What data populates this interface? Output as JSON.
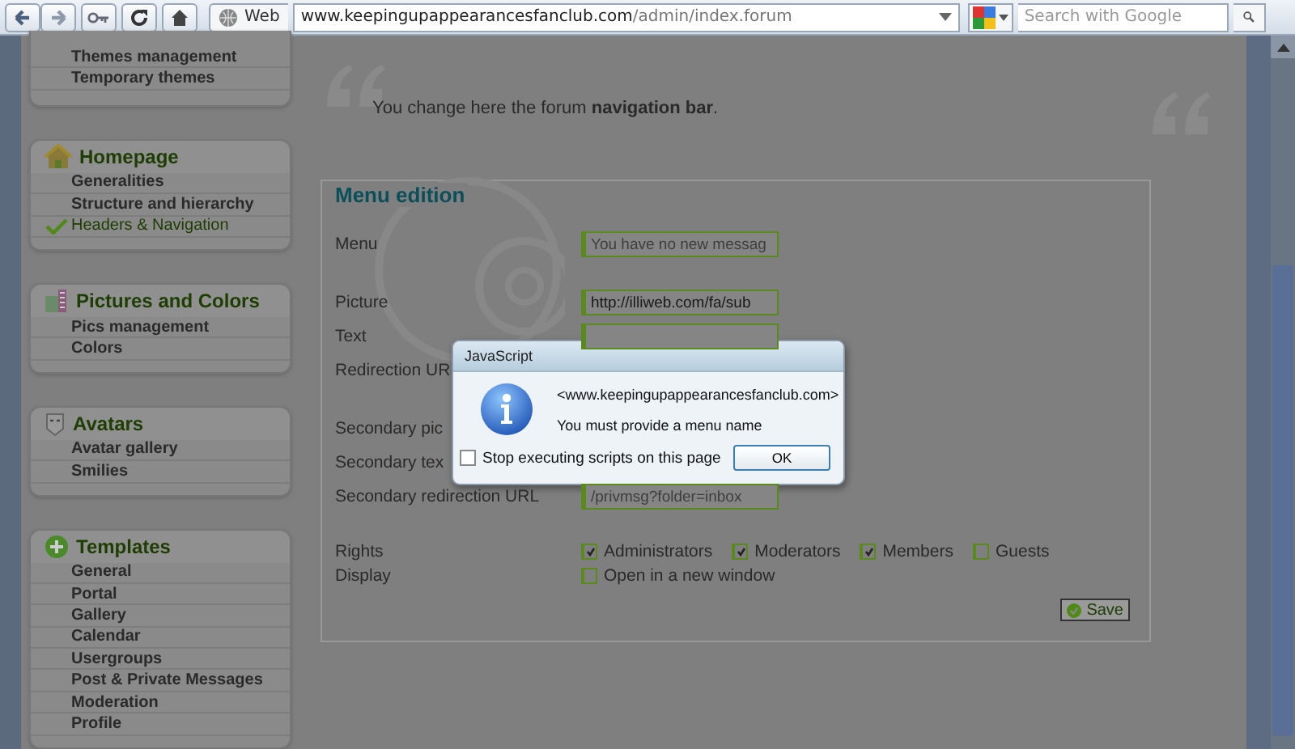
{
  "browser": {
    "site_label": "Web",
    "url_host": "www.keepingupappearancesfanclub.com",
    "url_path": "/admin/index.forum",
    "search": {
      "placeholder": "Search with Google"
    }
  },
  "sidebar": {
    "top_items": [
      "Themes management",
      "Temporary themes"
    ],
    "sections": [
      {
        "title": "Homepage",
        "items": [
          {
            "label": "Generalities",
            "selected": false
          },
          {
            "label": "Structure and hierarchy",
            "selected": false
          },
          {
            "label": "Headers & Navigation",
            "selected": true
          }
        ]
      },
      {
        "title": "Pictures and Colors",
        "items": [
          {
            "label": "Pics management",
            "selected": false
          },
          {
            "label": "Colors",
            "selected": false
          }
        ]
      },
      {
        "title": "Avatars",
        "items": [
          {
            "label": "Avatar gallery",
            "selected": false
          },
          {
            "label": "Smilies",
            "selected": false
          }
        ]
      },
      {
        "title": "Templates",
        "items": [
          {
            "label": "General",
            "selected": false
          },
          {
            "label": "Portal",
            "selected": false
          },
          {
            "label": "Gallery",
            "selected": false
          },
          {
            "label": "Calendar",
            "selected": false
          },
          {
            "label": "Usergroups",
            "selected": false
          },
          {
            "label": "Post & Private Messages",
            "selected": false
          },
          {
            "label": "Moderation",
            "selected": false
          },
          {
            "label": "Profile",
            "selected": false
          }
        ]
      }
    ]
  },
  "intro": "You change here the forum **navigation bar**.",
  "form": {
    "title": "Menu edition",
    "groups": [
      [
        {
          "kind": "text",
          "label": "Menu",
          "placeholder": "You have no new messag"
        }
      ],
      [
        {
          "kind": "text",
          "label": "Picture",
          "value": "http://illiweb.com/fa/sub"
        },
        {
          "kind": "text",
          "label": "Text"
        },
        {
          "kind": "label",
          "label": "Redirection UR"
        }
      ],
      [
        {
          "kind": "label",
          "label": "Secondary pic"
        },
        {
          "kind": "label",
          "label": "Secondary tex"
        },
        {
          "kind": "text",
          "label": "Secondary redirection URL",
          "placeholder": "/privmsg?folder=inbox"
        }
      ],
      [
        {
          "kind": "checks",
          "label": "Rights",
          "options": [
            {
              "label": "Administrators",
              "checked": true
            },
            {
              "label": "Moderators",
              "checked": true
            },
            {
              "label": "Members",
              "checked": true
            },
            {
              "label": "Guests",
              "checked": false
            }
          ]
        },
        {
          "kind": "checks",
          "label": "Display",
          "options": [
            {
              "label": "Open in a new window",
              "checked": false
            }
          ]
        }
      ]
    ],
    "save": "Save"
  },
  "dialog": {
    "title": "JavaScript",
    "origin": "<www.keepingupappearancesfanclub.com>",
    "message": "You must provide a menu name",
    "stop_scripts": {
      "label": "Stop executing scripts on this page",
      "checked": false
    },
    "button": "OK"
  }
}
